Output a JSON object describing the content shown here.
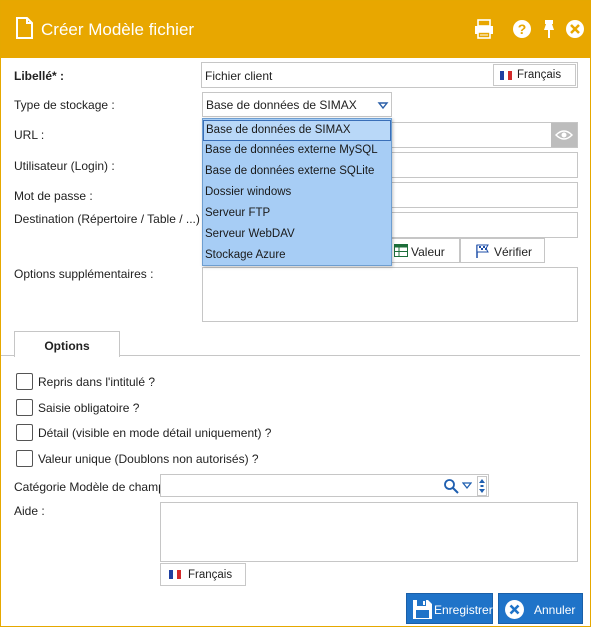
{
  "window": {
    "title": "Créer Modèle fichier",
    "icons": [
      "document-icon",
      "printer-icon",
      "help-icon",
      "pin-icon",
      "close-icon"
    ],
    "accent_color": "#e8a700"
  },
  "form": {
    "libelle_label": "Libellé* :",
    "libelle_value": "Fichier client",
    "libelle_lang": "Français",
    "type_label": "Type de stockage :",
    "type_value": "Base de données de SIMAX",
    "url_label": "URL :",
    "login_label": "Utilisateur (Login) :",
    "password_label": "Mot de passe :",
    "destination_label": "Destination (Répertoire / Table / ...) :",
    "valeur_button": "Valeur",
    "verifier_button": "Vérifier",
    "options_label": "Options supplémentaires :"
  },
  "dropdown": {
    "items": [
      "Base de données de SIMAX",
      "Base de données externe MySQL",
      "Base de données externe SQLite",
      "Dossier windows",
      "Serveur FTP",
      "Serveur WebDAV",
      "Stockage Azure"
    ],
    "selected_index": 0
  },
  "tabs": {
    "options": "Options"
  },
  "checkboxes": {
    "repris": "Repris dans l'intitulé ?",
    "saisie": "Saisie obligatoire ?",
    "detail": "Détail (visible en mode détail uniquement) ?",
    "unique": "Valeur unique (Doublons non autorisés) ?"
  },
  "categorie": {
    "label": "Catégorie Modèle de champ :"
  },
  "aide": {
    "label": "Aide :",
    "lang": "Français"
  },
  "actions": {
    "save": "Enregistrer",
    "cancel": "Annuler"
  }
}
